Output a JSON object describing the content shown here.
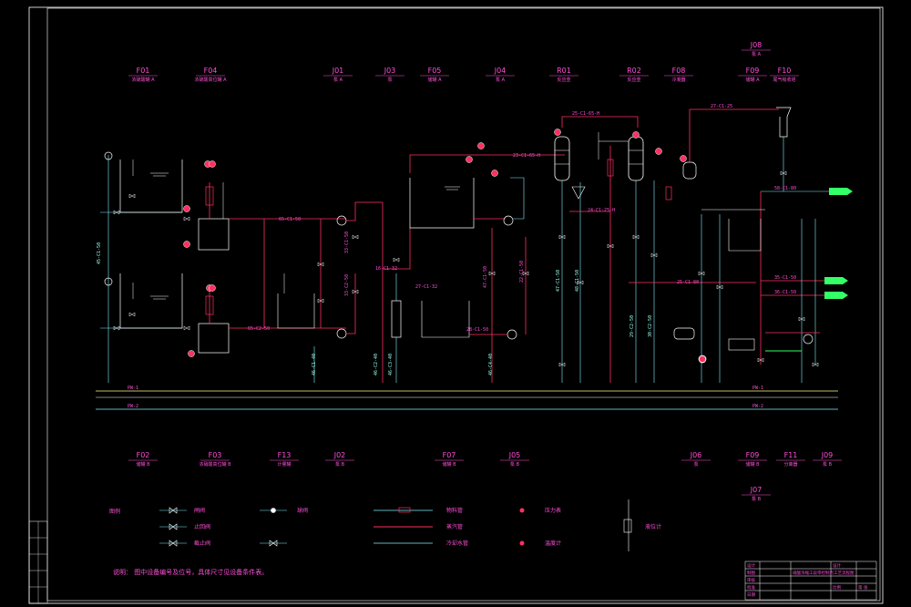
{
  "colors": {
    "background": "#000000",
    "frame": "#ffffff",
    "cyan_line": "#7ff0ff",
    "red_line": "#ff3060",
    "magenta_text": "#ff4fd8",
    "white_equipment": "#ffffff",
    "yellow_header": "#ffff80",
    "green_arrow": "#33ff66"
  },
  "top_tags": [
    {
      "tag": "F01",
      "desc": "浓硫酸罐 A"
    },
    {
      "tag": "F04",
      "desc": "浓硫酸高位罐 A"
    },
    {
      "tag": "J01",
      "desc": "泵 A"
    },
    {
      "tag": "J03",
      "desc": "泵"
    },
    {
      "tag": "F05",
      "desc": "储罐 A"
    },
    {
      "tag": "J04",
      "desc": "泵 A"
    },
    {
      "tag": "R01",
      "desc": "反应釜"
    },
    {
      "tag": "R02",
      "desc": "反应釜"
    },
    {
      "tag": "F08",
      "desc": "冷凝器"
    },
    {
      "tag": "F09",
      "desc": "储罐 A"
    },
    {
      "tag": "F10",
      "desc": "尾气吸收塔"
    },
    {
      "tag": "J08",
      "desc": "泵 A"
    }
  ],
  "bottom_tags": [
    {
      "tag": "F02",
      "desc": "储罐 B"
    },
    {
      "tag": "F03",
      "desc": "浓硝酸高位罐 B"
    },
    {
      "tag": "F13",
      "desc": "计量罐"
    },
    {
      "tag": "J02",
      "desc": "泵 B"
    },
    {
      "tag": "F07",
      "desc": "储罐 B"
    },
    {
      "tag": "J05",
      "desc": "泵 B"
    },
    {
      "tag": "J06",
      "desc": "泵"
    },
    {
      "tag": "F09",
      "desc": "储罐 B"
    },
    {
      "tag": "F11",
      "desc": "分离器"
    },
    {
      "tag": "J09",
      "desc": "泵 B"
    },
    {
      "tag": "J07",
      "desc": "泵 B"
    }
  ],
  "headers": {
    "water_supply": "PW-1",
    "water_return": "PW-2",
    "right_label": "PW-1",
    "right_label_2": "PW-2"
  },
  "legend": {
    "title": "图例",
    "items": [
      "闸阀",
      "止回阀",
      "截止阀",
      "球阀",
      "物料管",
      "蒸汽管",
      "冷却水管",
      "压力表",
      "温度计",
      "液位计"
    ]
  },
  "note": "说明： 图中设备编号及位号，具体尺寸见设备条件表。",
  "title_block": {
    "drawing_name": "硝酸浓缩工段带控制点工艺流程图",
    "company": "设计",
    "scale": "比例",
    "sheet": "第 张",
    "rows": [
      "设计",
      "制图",
      "审核",
      "批准",
      "日期"
    ]
  }
}
